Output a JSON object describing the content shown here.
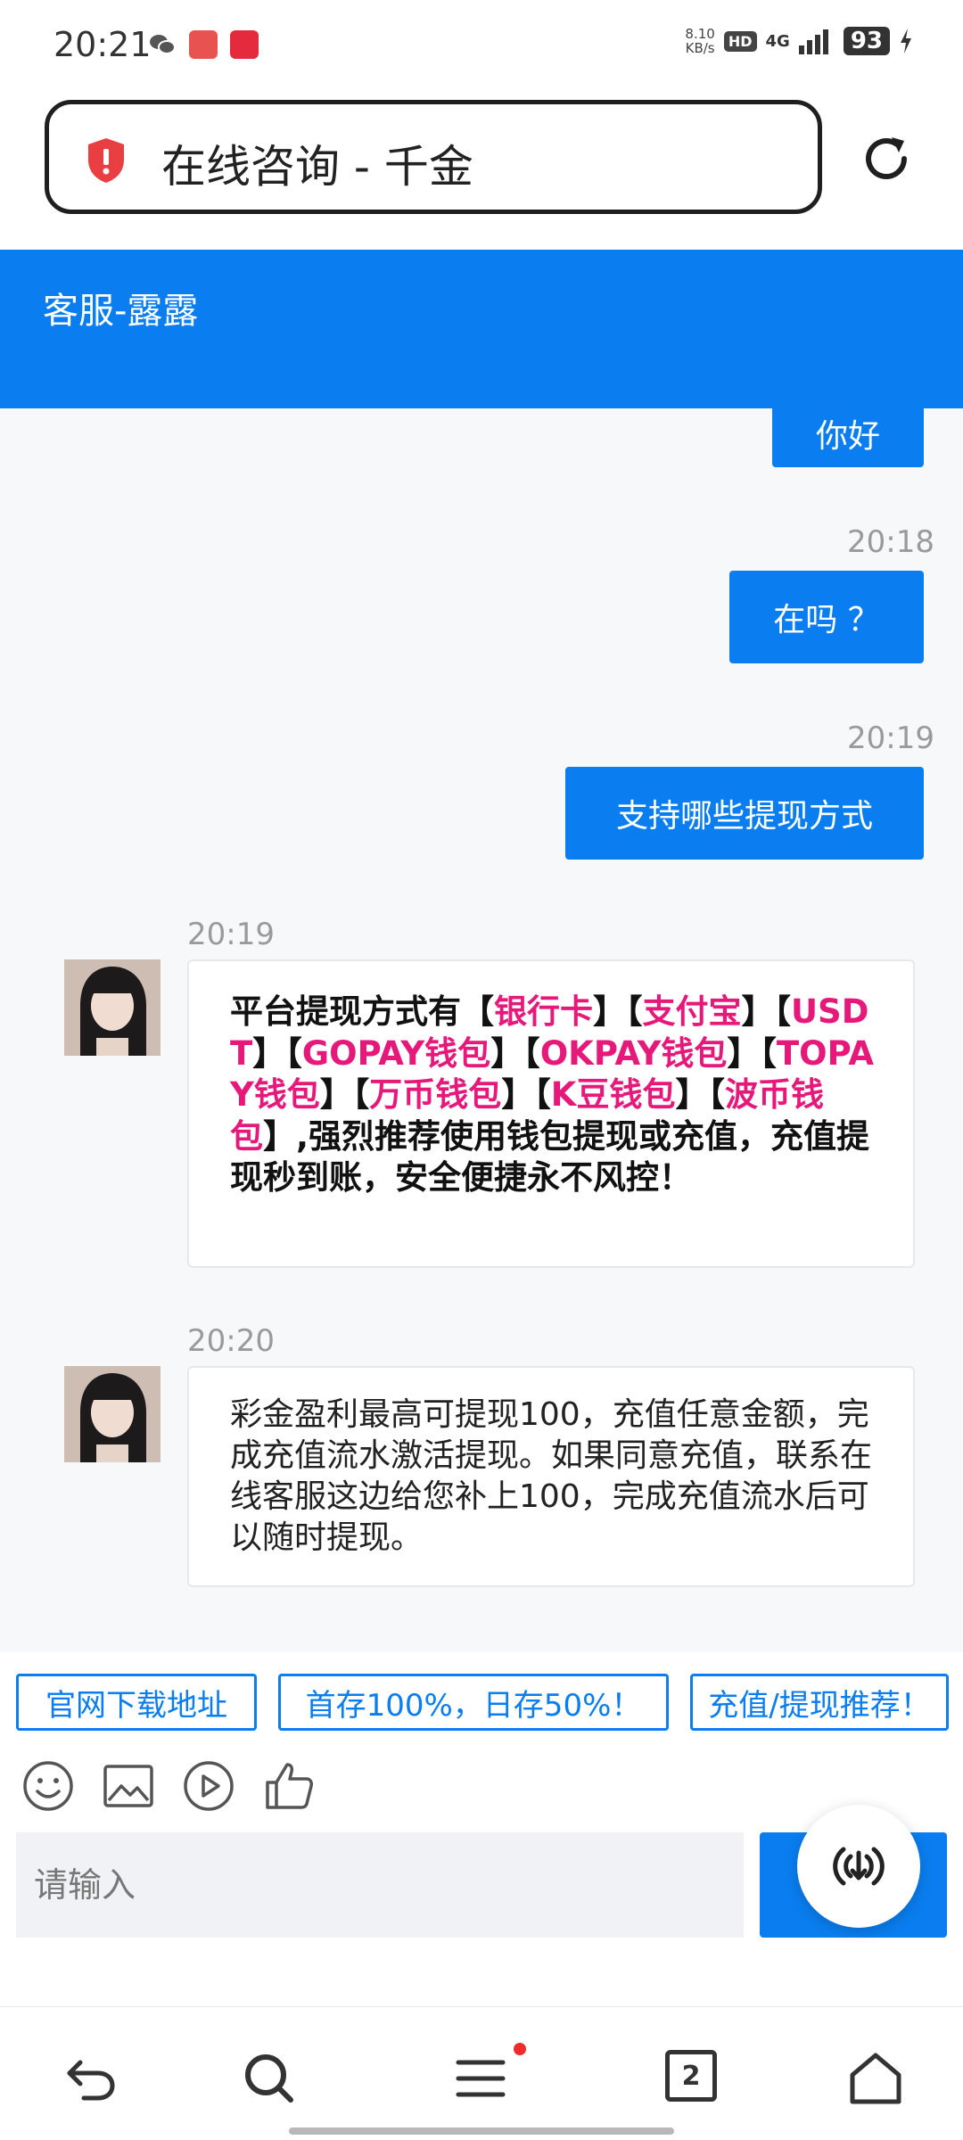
{
  "status_bar": {
    "time": "20:21",
    "net_speed_value": "8.10",
    "net_speed_unit": "KB/s",
    "hd": "HD",
    "network": "4G",
    "battery": "93"
  },
  "browser": {
    "page_title": "在线咨询 - 千金"
  },
  "chat": {
    "header_title": "客服-露露",
    "messages": [
      {
        "from": "user",
        "text": "你好"
      },
      {
        "from": "user",
        "time": "20:18",
        "text": "在吗 ？"
      },
      {
        "from": "user",
        "time": "20:19",
        "text": "支持哪些提现方式"
      },
      {
        "from": "agent",
        "time": "20:19",
        "segments": [
          {
            "text": "平台提现方式有【",
            "highlight": false
          },
          {
            "text": "银行卡",
            "highlight": true
          },
          {
            "text": "】【",
            "highlight": false
          },
          {
            "text": "支付宝",
            "highlight": true
          },
          {
            "text": "】【",
            "highlight": false
          },
          {
            "text": "USDT",
            "highlight": true
          },
          {
            "text": "】【",
            "highlight": false
          },
          {
            "text": "GOPAY钱包",
            "highlight": true
          },
          {
            "text": "】【",
            "highlight": false
          },
          {
            "text": "OKPAY钱包",
            "highlight": true
          },
          {
            "text": "】【",
            "highlight": false
          },
          {
            "text": "TOPAY钱包",
            "highlight": true
          },
          {
            "text": "】【",
            "highlight": false
          },
          {
            "text": "万币钱包",
            "highlight": true
          },
          {
            "text": "】【",
            "highlight": false
          },
          {
            "text": "K豆钱包",
            "highlight": true
          },
          {
            "text": "】【",
            "highlight": false
          },
          {
            "text": "波币钱包",
            "highlight": true
          },
          {
            "text": "】,强烈推荐使用钱包提现或充值，充值提现秒到账，安全便捷永不风控！",
            "highlight": false
          }
        ]
      },
      {
        "from": "agent",
        "time": "20:20",
        "text": "彩金盈利最高可提现100，充值任意金额，完成充值流水激活提现。如果同意充值，联系在线客服这边给您补上100，完成充值流水后可以随时提现。"
      }
    ]
  },
  "quick_replies": [
    "官网下载地址",
    "首存100%，日存50%！",
    "充值/提现推荐！"
  ],
  "input": {
    "placeholder": "请输入"
  },
  "bottom_nav": {
    "tab_count": "2"
  },
  "colors": {
    "accent": "#0a7ef0",
    "highlight": "#e6197a",
    "notification_dot": "#f02b2b"
  },
  "icons": [
    "wechat-icon",
    "shield-icon",
    "reload-icon",
    "emoji-icon",
    "image-icon",
    "video-icon",
    "thumbs-up-icon",
    "broadcast-icon",
    "back-icon",
    "search-icon",
    "menu-icon",
    "tabs-icon",
    "home-icon"
  ]
}
